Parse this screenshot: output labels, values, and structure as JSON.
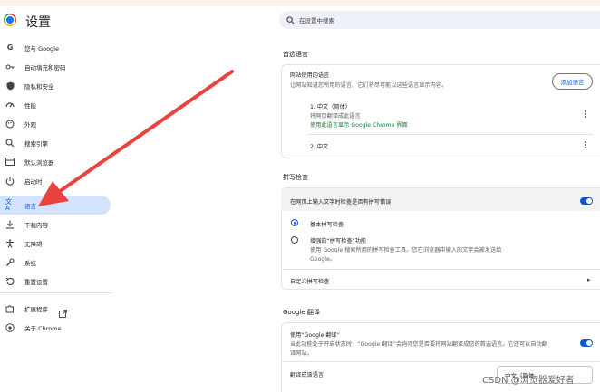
{
  "header": {
    "title": "设置",
    "search_placeholder": "在设置中搜索"
  },
  "sidebar": {
    "items": [
      {
        "label": "您与 Google",
        "icon": "google-icon"
      },
      {
        "label": "自动填充和密码",
        "icon": "key-icon"
      },
      {
        "label": "隐私和安全",
        "icon": "shield-icon"
      },
      {
        "label": "性能",
        "icon": "speedometer-icon"
      },
      {
        "label": "外观",
        "icon": "palette-icon"
      },
      {
        "label": "搜索引擎",
        "icon": "search-icon"
      },
      {
        "label": "默认浏览器",
        "icon": "browser-icon"
      },
      {
        "label": "启动时",
        "icon": "power-icon"
      },
      {
        "label": "语言",
        "icon": "translate-icon",
        "active": true
      },
      {
        "label": "下载内容",
        "icon": "download-icon"
      },
      {
        "label": "无障碍",
        "icon": "accessibility-icon"
      },
      {
        "label": "系统",
        "icon": "wrench-icon"
      },
      {
        "label": "重置设置",
        "icon": "reset-icon"
      },
      {
        "label": "扩展程序",
        "icon": "puzzle-icon"
      },
      {
        "label": "关于 Chrome",
        "icon": "chrome-icon"
      }
    ]
  },
  "preferred_languages": {
    "section_title": "首选语言",
    "card_title": "网站使用的语言",
    "card_desc": "让网站知道您所用的语言。它们将尽可能以这些语言显示内容。",
    "add_button": "添加语言",
    "languages": [
      {
        "name": "1. 中文（简体）",
        "line1": "将网页翻译成此语言",
        "line2": "使用此语言显示 Google Chrome 界面"
      },
      {
        "name": "2. 中文"
      }
    ]
  },
  "spellcheck": {
    "section_title": "拼写检查",
    "toggle_label": "在网页上输入文字时检查是否有拼写错误",
    "toggle_on": true,
    "options": [
      {
        "label": "基本拼写检查",
        "selected": true
      },
      {
        "label": "增强的“拼写检查”功能",
        "desc": "使用 Google 搜索所用的拼写检查工具。您在浏览器中输入的文字会被发送给",
        "desc2": "Google。",
        "selected": false
      }
    ],
    "custom_label": "自定义拼写检查"
  },
  "translate": {
    "section_title": "Google 翻译",
    "toggle_label": "使用“Google 翻译”",
    "desc_line1": "当此功能处于开启状态时，“Google 翻译”会询问您是否要将网站翻译成您的首选语言。它还可以自动翻",
    "desc_line2": "译网站。",
    "toggle_on": true,
    "target_label": "翻译成该语言",
    "target_value": "中文（简体"
  },
  "watermark": "CSDN @浏览器爱好者",
  "colors": {
    "accent": "#0b57d0",
    "active_bg": "#d3e3fd",
    "arrow": "#e8433f"
  }
}
